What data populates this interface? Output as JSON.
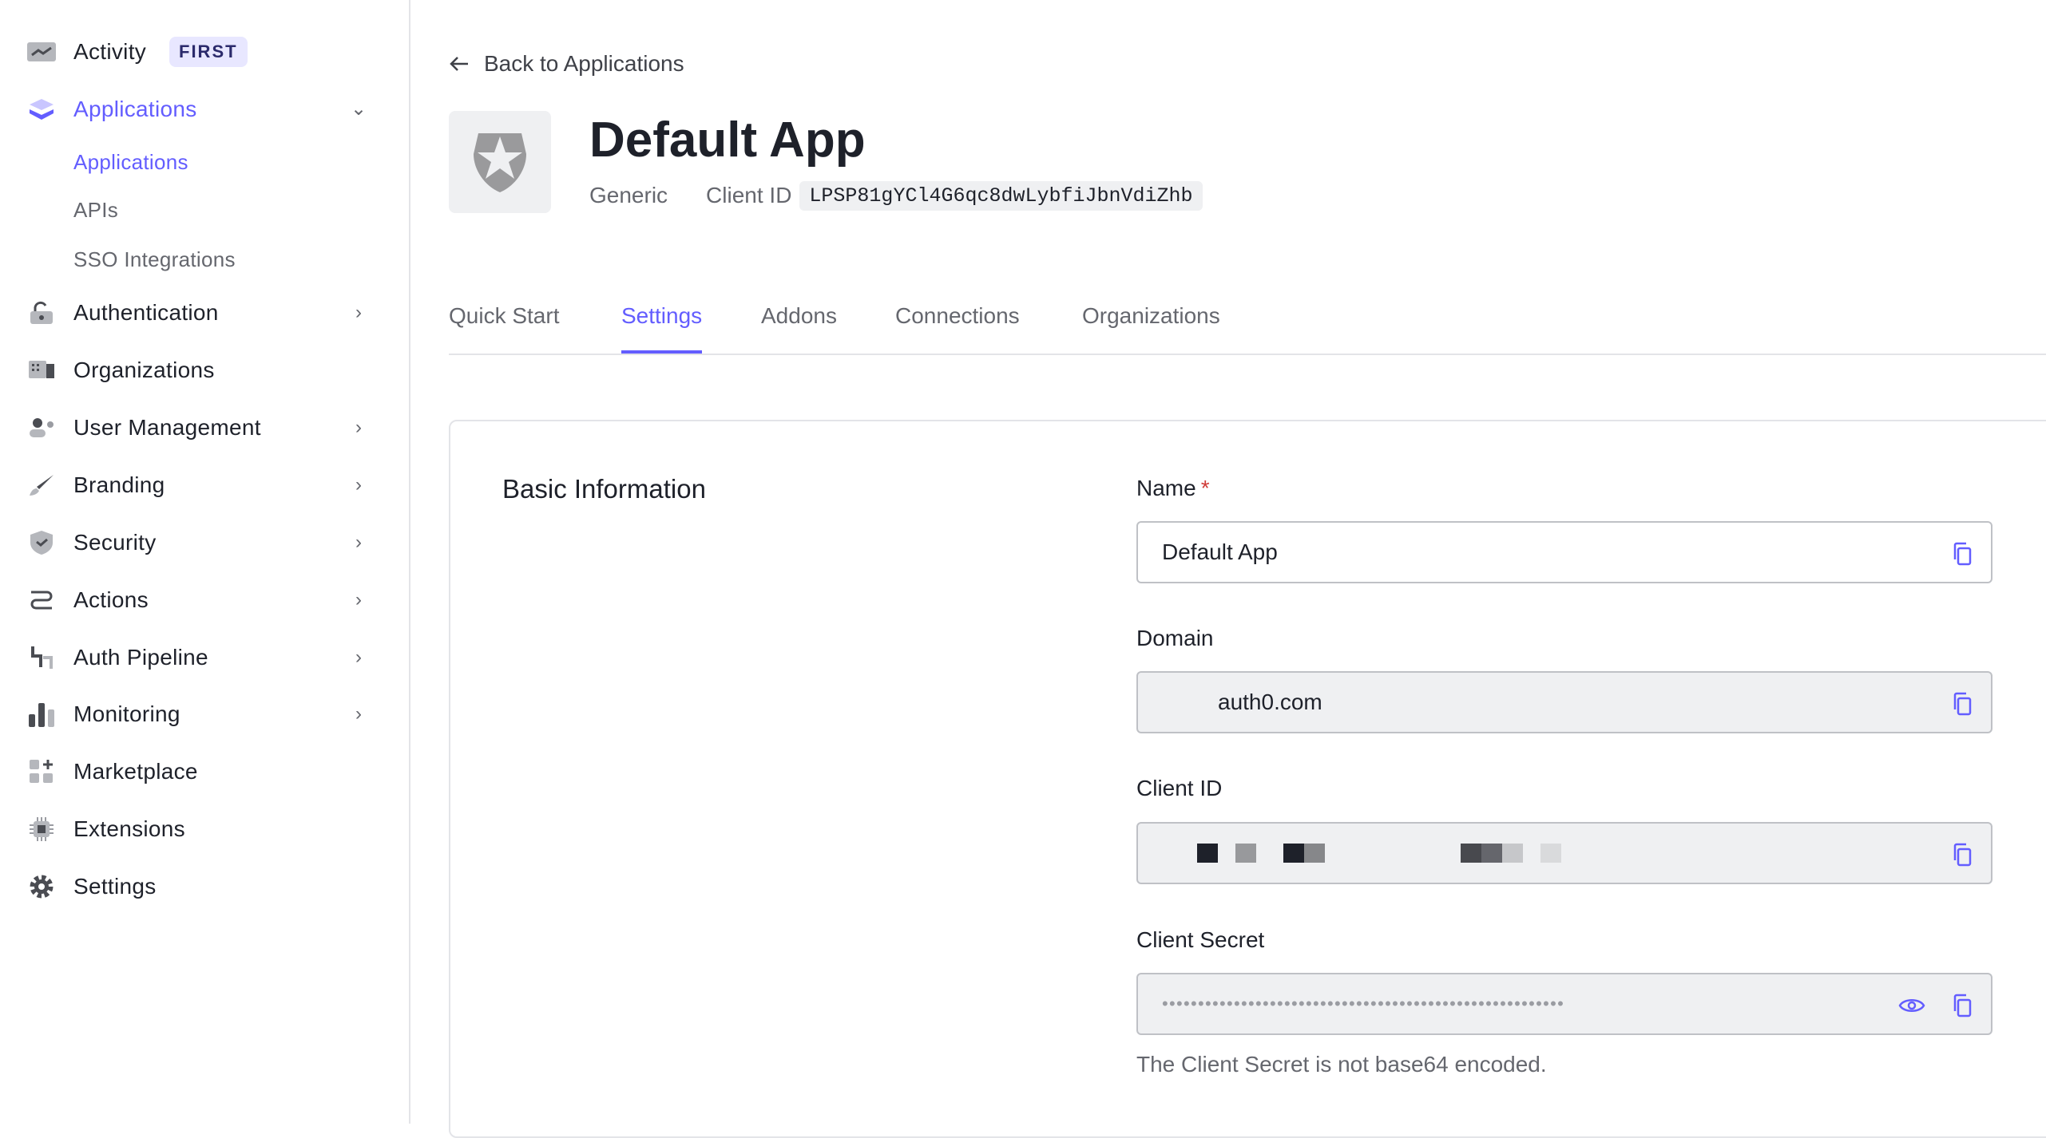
{
  "sidebar": {
    "activity": {
      "label": "Activity",
      "badge": "FIRST"
    },
    "items": [
      {
        "label": "Applications"
      },
      {
        "label": "Applications"
      },
      {
        "label": "APIs"
      },
      {
        "label": "SSO Integrations"
      },
      {
        "label": "Authentication"
      },
      {
        "label": "Organizations"
      },
      {
        "label": "User Management"
      },
      {
        "label": "Branding"
      },
      {
        "label": "Security"
      },
      {
        "label": "Actions"
      },
      {
        "label": "Auth Pipeline"
      },
      {
        "label": "Monitoring"
      },
      {
        "label": "Marketplace"
      },
      {
        "label": "Extensions"
      },
      {
        "label": "Settings"
      }
    ]
  },
  "header": {
    "back": "Back to Applications",
    "title": "Default App",
    "type": "Generic",
    "client_id_label": "Client ID",
    "client_id": "LPSP81gYCl4G6qc8dwLybfiJbnVdiZhb"
  },
  "tabs": [
    "Quick Start",
    "Settings",
    "Addons",
    "Connections",
    "Organizations"
  ],
  "form": {
    "section": "Basic Information",
    "name_label": "Name",
    "required": "*",
    "name_value": "Default App",
    "domain_label": "Domain",
    "domain_value": "auth0.com",
    "client_id_label": "Client ID",
    "secret_label": "Client Secret",
    "secret_value": "••••••••••••••••••••••••••••••••••••••••••••••••••••••••",
    "secret_help": "The Client Secret is not base64 encoded."
  },
  "colors": {
    "accent": "#635dff"
  }
}
